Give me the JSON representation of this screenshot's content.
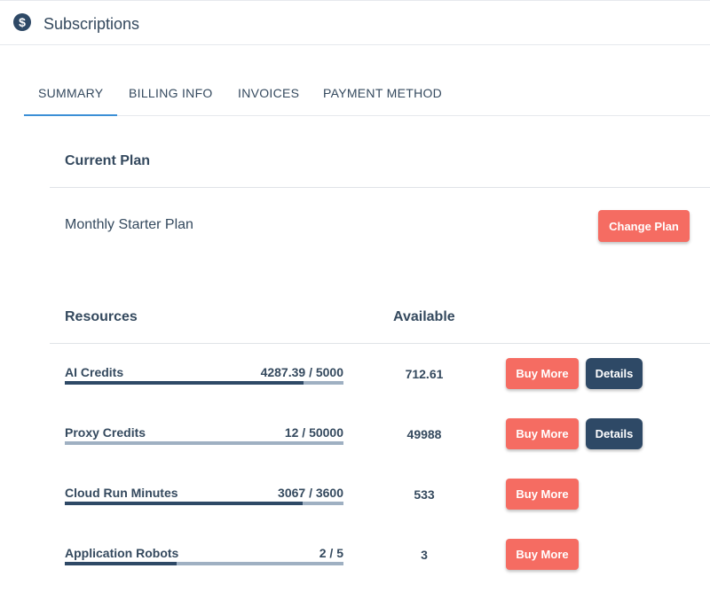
{
  "header": {
    "title": "Subscriptions",
    "icon": "dollar-circle-icon"
  },
  "tabs": [
    {
      "label": "SUMMARY",
      "active": true
    },
    {
      "label": "BILLING INFO",
      "active": false
    },
    {
      "label": "INVOICES",
      "active": false
    },
    {
      "label": "PAYMENT METHOD",
      "active": false
    }
  ],
  "current_plan": {
    "heading": "Current Plan",
    "plan_name": "Monthly Starter Plan",
    "change_button": "Change Plan"
  },
  "resources": {
    "col_resources": "Resources",
    "col_available": "Available",
    "buy_label": "Buy More",
    "details_label": "Details",
    "items": [
      {
        "name": "AI Credits",
        "usage": "4287.39 / 5000",
        "progress": 0.857,
        "available": "712.61",
        "has_details": true
      },
      {
        "name": "Proxy Credits",
        "usage": "12 / 50000",
        "progress": 0.0002,
        "available": "49988",
        "has_details": true
      },
      {
        "name": "Cloud Run Minutes",
        "usage": "3067 / 3600",
        "progress": 0.852,
        "available": "533",
        "has_details": false
      },
      {
        "name": "Application Robots",
        "usage": "2 / 5",
        "progress": 0.4,
        "available": "3",
        "has_details": false
      }
    ]
  },
  "colors": {
    "accent": "#3b8fd6",
    "coral": "#f56c62",
    "navy": "#2e4966",
    "text": "#34495e"
  }
}
